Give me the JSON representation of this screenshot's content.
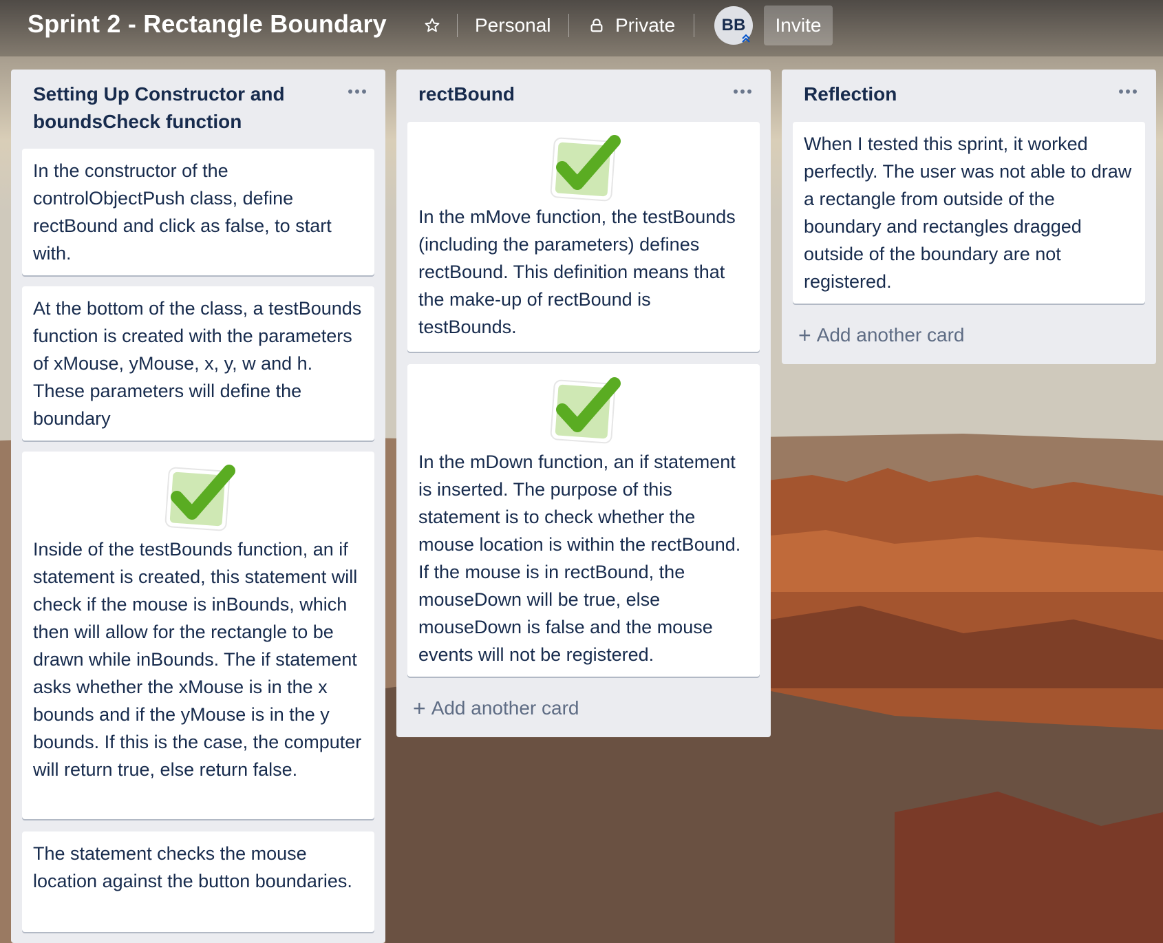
{
  "header": {
    "board_title": "Sprint 2 - Rectangle Boundary",
    "star_icon": "star-icon",
    "personal_label": "Personal",
    "private_label": "Private",
    "lock_icon": "lock-icon",
    "avatar_initials": "BB",
    "invite_label": "Invite"
  },
  "lists": [
    {
      "title": "Setting Up Constructor and boundsCheck function",
      "cards": [
        {
          "text": "In the constructor of the controlObjectPush class, define rectBound and click as false, to start with."
        },
        {
          "text": "At the bottom of the class, a testBounds function is created with the parameters of xMouse, yMouse, x, y, w and h. These parameters will define the boundary"
        },
        {
          "text": "Inside of the testBounds function, an if statement is created, this statement will check if the mouse is inBounds, which then will allow for the rectangle to be drawn while inBounds. The if statement asks whether the xMouse is in the x bounds and if the yMouse is in the y bounds. If this is the case, the computer will return true, else return false.",
          "image": "green-checkmark"
        },
        {
          "text": "The statement checks the mouse location against the button boundaries."
        }
      ]
    },
    {
      "title": "rectBound",
      "cards": [
        {
          "text": "In the mMove function, the testBounds (including the parameters) defines rectBound. This definition means that the make-up of rectBound is testBounds.",
          "image": "green-checkmark"
        },
        {
          "text": "In the mDown function, an if statement is inserted. The purpose of this statement is to check whether the mouse location is within the rectBound. If the mouse is in rectBound, the mouseDown will be true, else mouseDown is false and the mouse events will not be registered.",
          "image": "green-checkmark"
        }
      ],
      "add_card_label": "Add another card"
    },
    {
      "title": "Reflection",
      "cards": [
        {
          "text": "When I tested this sprint, it worked perfectly. The user was not able to draw a rectangle from outside of the boundary and rectangles dragged outside of the boundary are not registered."
        }
      ],
      "add_card_label": "Add another card"
    }
  ],
  "colors": {
    "list_bg": "#ebecf0",
    "card_text": "#172b4d",
    "muted_text": "#5e6c84",
    "check_green": "#5aac22"
  }
}
